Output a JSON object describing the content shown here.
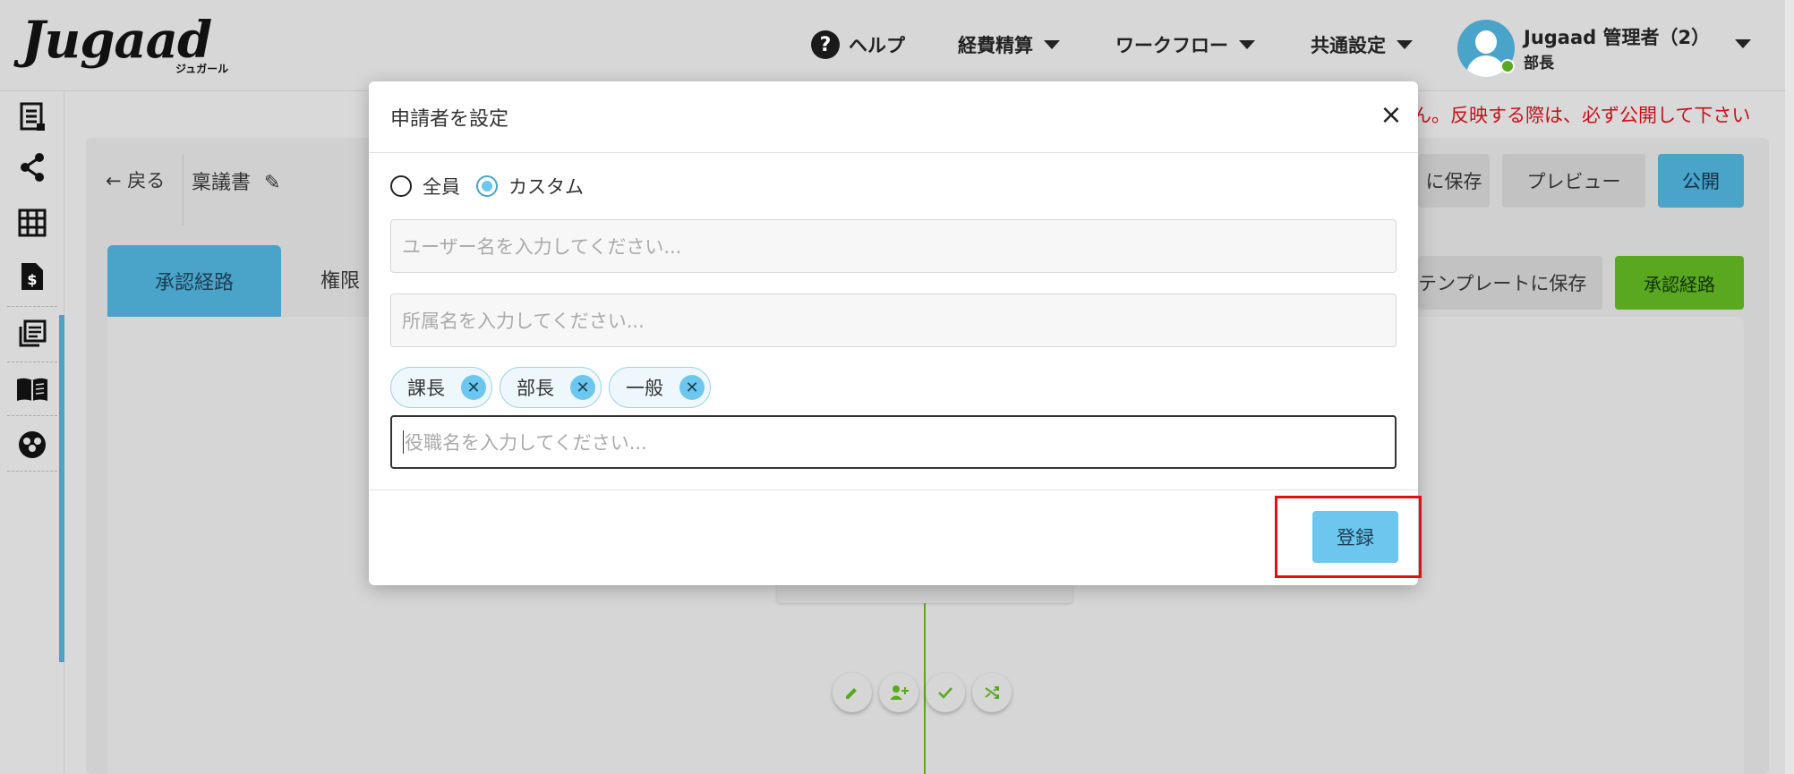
{
  "header": {
    "logo_text": "Jugaad",
    "logo_subtext": "ジュガール",
    "nav": {
      "help": "ヘルプ",
      "expenses": "経費精算",
      "workflow": "ワークフロー",
      "common_settings": "共通設定"
    },
    "user": {
      "name": "Jugaad 管理者（2）",
      "role": "部長"
    }
  },
  "sidebar": {
    "icons": [
      "receipt-icon",
      "share-icon",
      "grid-icon",
      "document-dollar-icon",
      "list-icon",
      "book-icon",
      "group-icon"
    ]
  },
  "page": {
    "banner_text": "ん。反映する際は、必ず公開して下さい",
    "back_label": "← 戻る",
    "doc_title": "稟議書",
    "save_label": "に保存",
    "preview_label": "プレビュー",
    "publish_label": "公開",
    "template_save_label": "テンプレートに保存",
    "approval_route_button": "承認経路",
    "tabs": {
      "active": "承認経路",
      "inactive": "権限"
    }
  },
  "modal": {
    "title": "申請者を設定",
    "close_symbol": "×",
    "radio_all": "全員",
    "radio_custom": "カスタム",
    "selected_radio": "custom",
    "user_placeholder": "ユーザー名を入力してください...",
    "dept_placeholder": "所属名を入力してください...",
    "chips": [
      "課長",
      "部長",
      "一般"
    ],
    "chip_remove_symbol": "✕",
    "position_placeholder": "役職名を入力してください...",
    "submit_label": "登録"
  },
  "colors": {
    "accent_blue": "#4aa3c8",
    "light_blue": "#6cc6ee",
    "green": "#5aa820",
    "alert_red": "#c8101b",
    "highlight_red": "#e0101b"
  }
}
